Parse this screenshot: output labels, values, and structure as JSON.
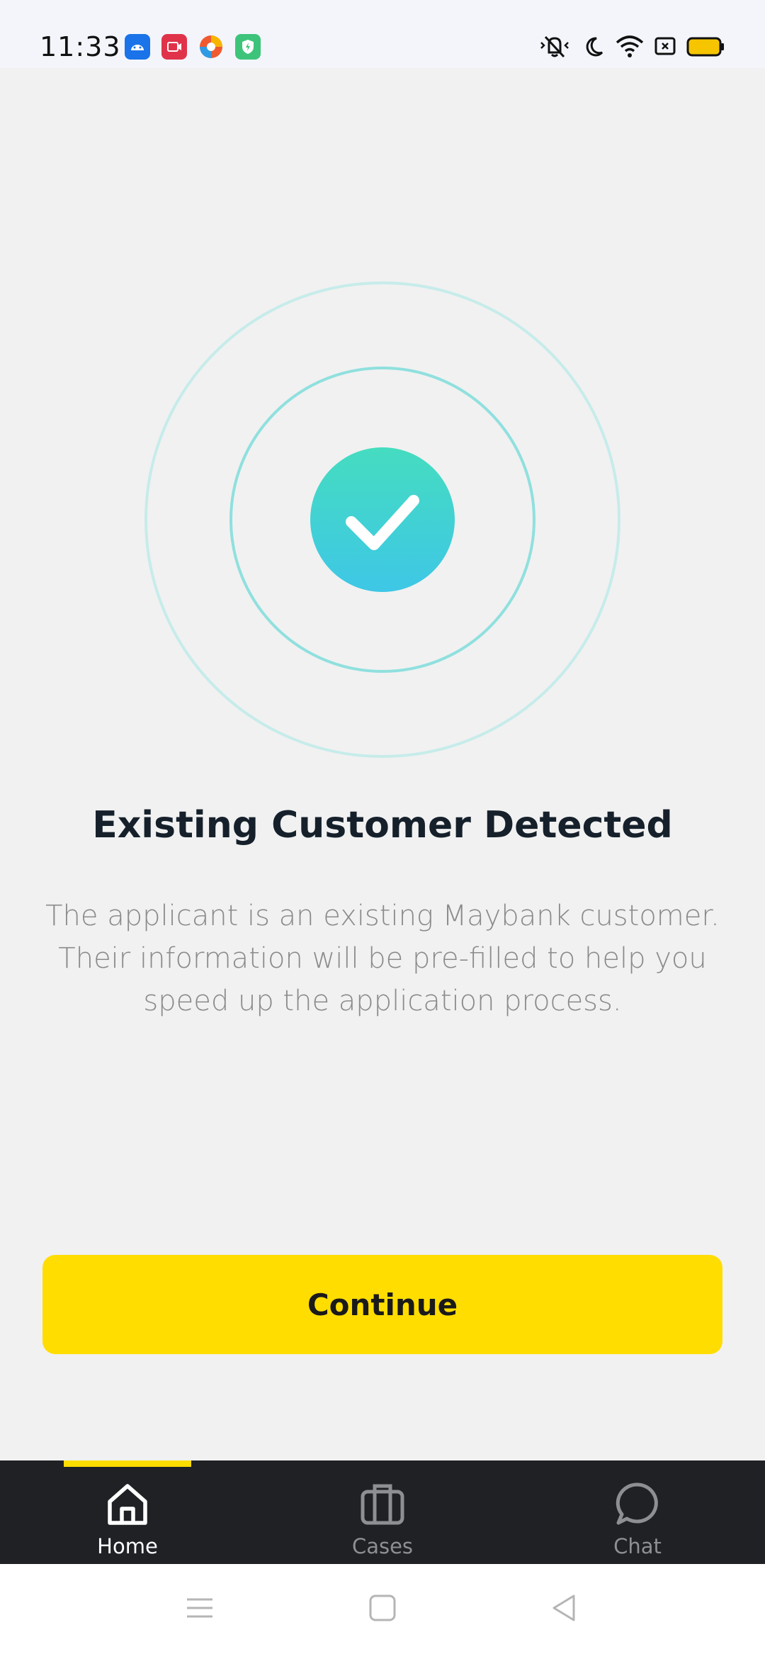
{
  "status_bar": {
    "time": "11:33",
    "notification_icons": [
      "android-icon",
      "video-recorder-icon",
      "browser-icon",
      "shield-icon"
    ],
    "system_icons": [
      "vibrate-icon",
      "moon-icon",
      "wifi-icon",
      "sim-icon",
      "battery-icon"
    ],
    "battery_color": "#f7c500"
  },
  "main": {
    "title": "Existing Customer Detected",
    "description": "The applicant is an existing Maybank customer. Their information will be pre-filled to help you speed up the application process.",
    "continue_label": "Continue"
  },
  "bottom_nav": {
    "items": [
      {
        "label": "Home",
        "icon": "home-icon",
        "active": true
      },
      {
        "label": "Cases",
        "icon": "briefcase-icon",
        "active": false
      },
      {
        "label": "Chat",
        "icon": "chat-icon",
        "active": false
      }
    ]
  },
  "colors": {
    "accent": "#ffdd00",
    "check_gradient_top": "#45dcc0",
    "check_gradient_bottom": "#3ec7e6",
    "ring": "#8fe0de",
    "nav_bg": "#1f2125"
  }
}
